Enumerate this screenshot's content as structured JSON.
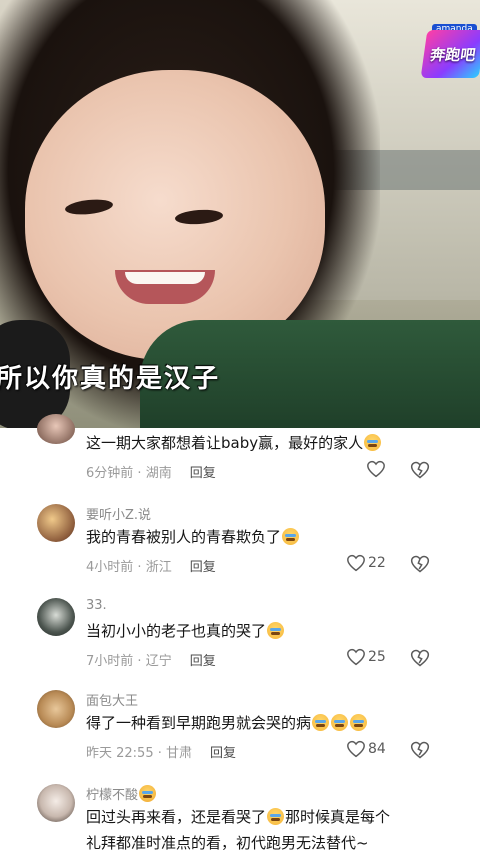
{
  "video": {
    "subtitle": "所以你真的是汉子",
    "logo_small": "amanda",
    "logo_text": "奔跑吧"
  },
  "comments": [
    {
      "username": "",
      "text": "这一期大家都想着让baby赢，最好的家人",
      "emoji_count": 1,
      "time": "6分钟前",
      "location": "湖南",
      "reply": "回复",
      "likes": ""
    },
    {
      "username": "要听小Z.说",
      "text": "我的青春被别人的青春欺负了",
      "emoji_count": 1,
      "time": "4小时前",
      "location": "浙江",
      "reply": "回复",
      "likes": "22"
    },
    {
      "username": "33.",
      "text": "当初小小的老子也真的哭了",
      "emoji_count": 1,
      "time": "7小时前",
      "location": "辽宁",
      "reply": "回复",
      "likes": "25"
    },
    {
      "username": "面包大王",
      "text": "得了一种看到早期跑男就会哭的病",
      "emoji_count": 3,
      "time": "昨天 22:55",
      "location": "甘肃",
      "reply": "回复",
      "likes": "84"
    },
    {
      "username": "柠檬不酸",
      "text1": "回过头再来看，还是看哭了",
      "text2": "那时候真是每个",
      "text3": "礼拜都准时准点的看，初代跑男无法替代~"
    }
  ],
  "colors": {
    "meta": "#9a9a9a",
    "text": "#161616",
    "username": "#8a8a8a"
  }
}
